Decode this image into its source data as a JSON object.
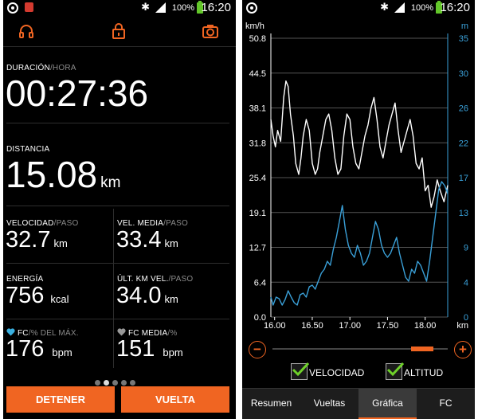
{
  "left_screen": {
    "status": {
      "time": "16:20",
      "battery": "100%"
    },
    "toolbar_icons": [
      "headphones-icon",
      "lock-icon",
      "camera-icon"
    ],
    "duration": {
      "label": "DURACIÓN",
      "sublabel": "/HORA",
      "value": "00:27:36"
    },
    "distance": {
      "label": "DISTANCIA",
      "value": "15.08",
      "unit": "km"
    },
    "speed": {
      "label": "VELOCIDAD",
      "sublabel": "/PASO",
      "value": "32.7",
      "unit": "km"
    },
    "avg_speed": {
      "label": "VEL. MEDIA",
      "sublabel": "/PASO",
      "value": "33.4",
      "unit": "km"
    },
    "energy": {
      "label": "ENERGÍA",
      "value": "756",
      "unit": "kcal"
    },
    "last_km": {
      "label": "ÚLT. KM VEL.",
      "sublabel": "/PASO",
      "value": "34.0",
      "unit": "km"
    },
    "hr": {
      "label": "FC",
      "sublabel": "/% DEL MÁX.",
      "value": "176",
      "unit": "bpm"
    },
    "avg_hr": {
      "label": "FC MEDIA",
      "sublabel": "/%",
      "value": "151",
      "unit": "bpm"
    },
    "pages": {
      "count": 5,
      "active": 1
    },
    "stop_button": "DETENER",
    "lap_button": "VUELTA",
    "colors": {
      "accent": "#f06522",
      "heart_blue": "#3ab0e0",
      "heart_gray": "#999999"
    }
  },
  "right_screen": {
    "status": {
      "time": "16:20",
      "battery": "100%"
    },
    "chart_data": {
      "type": "line",
      "x_ticks": [
        "16.00",
        "16.50",
        "17.00",
        "17.50",
        "18.00"
      ],
      "x_unit": "km",
      "left_axis": {
        "unit": "km/h",
        "ticks": [
          "50.8",
          "44.5",
          "38.1",
          "31.8",
          "25.4",
          "19.1",
          "12.7",
          "6.4",
          "0.0"
        ],
        "range": [
          0,
          50.8
        ]
      },
      "right_axis": {
        "unit": "m",
        "ticks": [
          "35",
          "30",
          "26",
          "22",
          "17",
          "13",
          "9",
          "4",
          "0"
        ],
        "range": [
          0,
          35
        ]
      },
      "series": [
        {
          "name": "VELOCIDAD",
          "axis": "left",
          "color": "#ffffff",
          "x": [
            15.95,
            15.98,
            16.01,
            16.04,
            16.08,
            16.12,
            16.15,
            16.18,
            16.21,
            16.25,
            16.28,
            16.32,
            16.35,
            16.38,
            16.42,
            16.46,
            16.5,
            16.54,
            16.57,
            16.6,
            16.64,
            16.68,
            16.72,
            16.76,
            16.8,
            16.84,
            16.88,
            16.92,
            16.96,
            17.0,
            17.04,
            17.08,
            17.12,
            17.16,
            17.2,
            17.24,
            17.28,
            17.32,
            17.36,
            17.4,
            17.44,
            17.48,
            17.52,
            17.56,
            17.6,
            17.64,
            17.68,
            17.72,
            17.76,
            17.8,
            17.84,
            17.88,
            17.92,
            17.96,
            18.0,
            18.04,
            18.08,
            18.12,
            18.16,
            18.2,
            18.25,
            18.3
          ],
          "values": [
            36,
            33,
            31,
            34,
            32,
            40,
            43,
            42,
            37,
            33,
            28,
            26,
            29,
            33,
            36,
            34,
            28,
            26,
            27,
            30,
            33,
            36,
            37,
            34,
            29,
            26,
            27,
            33,
            37,
            36,
            31,
            28,
            27,
            30,
            33,
            35,
            38,
            40,
            36,
            31,
            29,
            32,
            35,
            37,
            39,
            34,
            30,
            32,
            34,
            36,
            33,
            28,
            27,
            29,
            23,
            24,
            20,
            22,
            25,
            23,
            21,
            24
          ]
        },
        {
          "name": "ALTITUD",
          "axis": "right",
          "color": "#3aa0d8",
          "x": [
            15.95,
            15.98,
            16.02,
            16.06,
            16.1,
            16.14,
            16.18,
            16.22,
            16.26,
            16.3,
            16.34,
            16.38,
            16.42,
            16.46,
            16.5,
            16.54,
            16.58,
            16.62,
            16.66,
            16.7,
            16.74,
            16.78,
            16.82,
            16.86,
            16.9,
            16.94,
            16.98,
            17.02,
            17.06,
            17.1,
            17.14,
            17.18,
            17.22,
            17.26,
            17.3,
            17.34,
            17.38,
            17.42,
            17.46,
            17.5,
            17.54,
            17.58,
            17.62,
            17.66,
            17.7,
            17.74,
            17.78,
            17.82,
            17.86,
            17.9,
            17.94,
            17.98,
            18.02,
            18.06,
            18.1,
            18.14,
            18.18,
            18.22,
            18.26,
            18.3
          ],
          "values": [
            2.5,
            1.5,
            2.5,
            2.3,
            1.5,
            2.2,
            3.3,
            2.5,
            1.8,
            1.5,
            2.8,
            3.0,
            2.5,
            3.8,
            4.0,
            3.5,
            4.5,
            5.5,
            6.0,
            7.0,
            6.5,
            8.5,
            10,
            12,
            14,
            11,
            9,
            8,
            7.5,
            9,
            8,
            6.5,
            7,
            8,
            10,
            12,
            11,
            9,
            8,
            7.5,
            8,
            9,
            10,
            8,
            6.5,
            5,
            4.5,
            6,
            5.5,
            7,
            6.5,
            5.5,
            4.5,
            7,
            10,
            13,
            16,
            17,
            16.5,
            15.5
          ]
        }
      ]
    },
    "checkboxes": [
      {
        "label": "VELOCIDAD",
        "checked": true
      },
      {
        "label": "ALTITUD",
        "checked": true
      }
    ],
    "tabs": [
      {
        "label": "Resumen"
      },
      {
        "label": "Vueltas"
      },
      {
        "label": "Gráfica"
      },
      {
        "label": "FC"
      }
    ],
    "active_tab": "Gráfica"
  }
}
